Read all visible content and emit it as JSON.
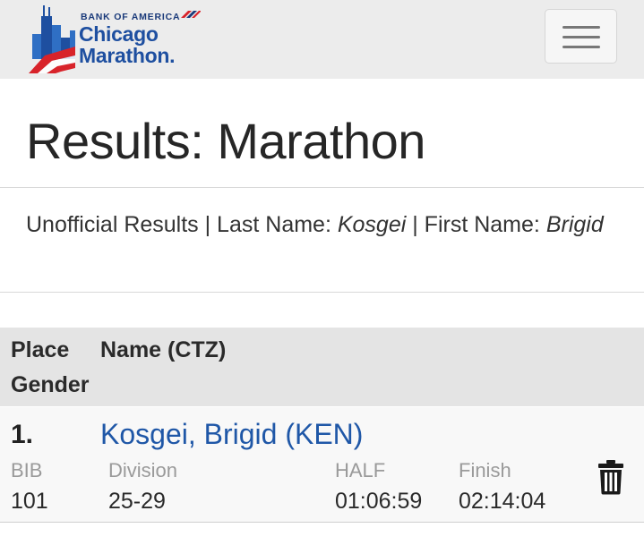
{
  "header": {
    "logo": {
      "sponsor": "BANK OF AMERICA",
      "line1": "Chicago",
      "line2": "Marathon."
    },
    "menu_icon": "hamburger-menu-icon"
  },
  "page_title": "Results: Marathon",
  "filter": {
    "prefix": "Unofficial Results | Last Name: ",
    "last_name": "Kosgei",
    "middle": " | First Name: ",
    "first_name": "Brigid"
  },
  "table": {
    "headers": {
      "place": "Place",
      "name": "Name (CTZ)",
      "gender": "Gender"
    },
    "rows": [
      {
        "place": "1.",
        "name": "Kosgei, Brigid (KEN)",
        "bib_label": "BIB",
        "bib": "101",
        "division_label": "Division",
        "division": "25-29",
        "half_label": "HALF",
        "half": "01:06:59",
        "finish_label": "Finish",
        "finish": "02:14:04",
        "action_icon": "trash-icon"
      }
    ]
  },
  "colors": {
    "link": "#1f57a7",
    "header_bg": "#ececec",
    "table_header_bg": "#e4e4e4",
    "logo_blue": "#1e4fa0",
    "logo_red": "#d8232a"
  }
}
